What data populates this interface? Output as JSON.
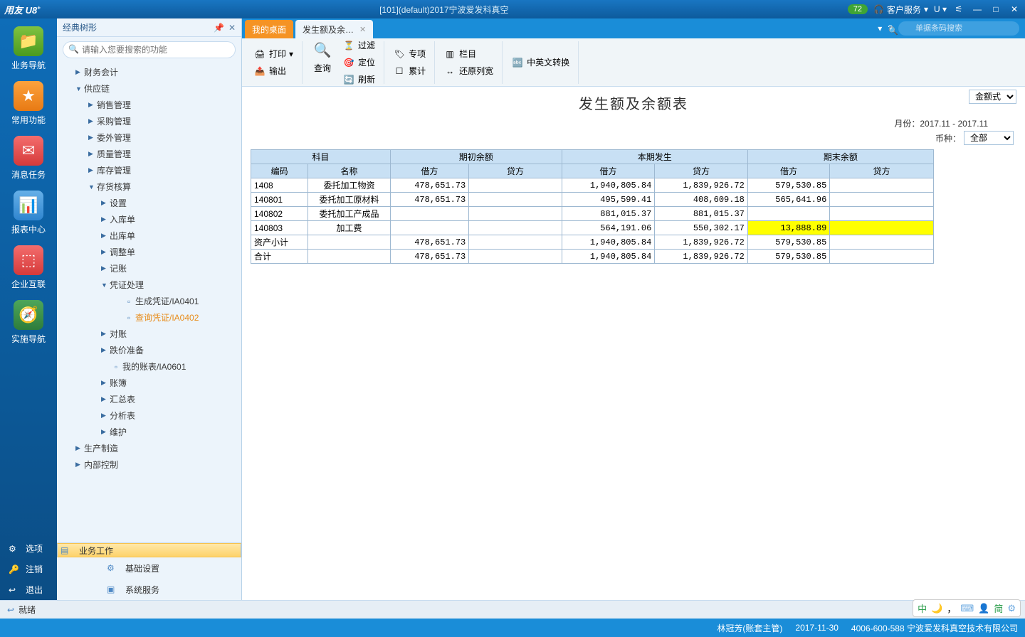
{
  "titlebar": {
    "logo": "用友 U8",
    "logo_sup": "+",
    "path": "[101](default)2017宁波爱发科真空",
    "badge": "72",
    "service": "客户服务",
    "u": "U"
  },
  "leftrail": {
    "items": [
      {
        "label": "业务导航"
      },
      {
        "label": "常用功能"
      },
      {
        "label": "消息任务"
      },
      {
        "label": "报表中心"
      },
      {
        "label": "企业互联"
      },
      {
        "label": "实施导航"
      }
    ],
    "bottom": [
      {
        "label": "选项",
        "icon": "⚙"
      },
      {
        "label": "注销",
        "icon": "🔑"
      },
      {
        "label": "退出",
        "icon": "↩"
      }
    ]
  },
  "treepanel": {
    "title": "经典树形",
    "search_placeholder": "请输入您要搜索的功能",
    "nodes": [
      {
        "lv": 1,
        "arrow": "▶",
        "label": "财务会计"
      },
      {
        "lv": 1,
        "arrow": "▼",
        "label": "供应链"
      },
      {
        "lv": 2,
        "arrow": "▶",
        "label": "销售管理"
      },
      {
        "lv": 2,
        "arrow": "▶",
        "label": "采购管理"
      },
      {
        "lv": 2,
        "arrow": "▶",
        "label": "委外管理"
      },
      {
        "lv": 2,
        "arrow": "▶",
        "label": "质量管理"
      },
      {
        "lv": 2,
        "arrow": "▶",
        "label": "库存管理"
      },
      {
        "lv": 2,
        "arrow": "▼",
        "label": "存货核算"
      },
      {
        "lv": 3,
        "arrow": "▶",
        "label": "设置"
      },
      {
        "lv": 3,
        "arrow": "▶",
        "label": "入库单"
      },
      {
        "lv": 3,
        "arrow": "▶",
        "label": "出库单"
      },
      {
        "lv": 3,
        "arrow": "▶",
        "label": "调整单"
      },
      {
        "lv": 3,
        "arrow": "▶",
        "label": "记账"
      },
      {
        "lv": 3,
        "arrow": "▼",
        "label": "凭证处理"
      },
      {
        "lv": 4,
        "arrow": "",
        "icon": "▫",
        "label": "生成凭证/IA0401"
      },
      {
        "lv": 4,
        "arrow": "",
        "icon": "▫",
        "label": "查询凭证/IA0402",
        "active": true
      },
      {
        "lv": 3,
        "arrow": "▶",
        "label": "对账"
      },
      {
        "lv": 3,
        "arrow": "▶",
        "label": "跌价准备"
      },
      {
        "lv": 3,
        "arrow": "",
        "icon": "▫",
        "label": "我的账表/IA0601"
      },
      {
        "lv": 3,
        "arrow": "▶",
        "label": "账簿"
      },
      {
        "lv": 3,
        "arrow": "▶",
        "label": "汇总表"
      },
      {
        "lv": 3,
        "arrow": "▶",
        "label": "分析表"
      },
      {
        "lv": 3,
        "arrow": "▶",
        "label": "维护"
      },
      {
        "lv": 1,
        "arrow": "▶",
        "label": "生产制造"
      },
      {
        "lv": 1,
        "arrow": "▶",
        "label": "内部控制"
      }
    ],
    "footer": [
      {
        "label": "业务工作",
        "sel": true,
        "icon": "▤"
      },
      {
        "label": "基础设置",
        "sel": false,
        "icon": "⚙"
      },
      {
        "label": "系统服务",
        "sel": false,
        "icon": "▣"
      }
    ]
  },
  "tabs": {
    "desktop": "我的桌面",
    "active": "发生额及余…",
    "search_placeholder": "单据条码搜索"
  },
  "toolbar": {
    "print": "打印",
    "output": "输出",
    "query": "查询",
    "filter": "过滤",
    "locate": "定位",
    "refresh": "刷新",
    "spec": "专项",
    "cum": "累计",
    "column": "栏目",
    "restore": "还原列宽",
    "ce": "中英文转换"
  },
  "report": {
    "title": "发生额及余额表",
    "month_label": "月份：",
    "month_value": "2017.11 - 2017.11",
    "currency_label": "币种：",
    "currency_value": "全部",
    "money_label": "金额式",
    "headers": {
      "subject": "科目",
      "code": "编码",
      "name": "名称",
      "begin": "期初余额",
      "period": "本期发生",
      "end": "期末余额",
      "dr": "借方",
      "cr": "贷方"
    },
    "rows": [
      {
        "code": "1408",
        "name": "委托加工物资",
        "bdr": "478,651.73",
        "bcr": "",
        "pdr": "1,940,805.84",
        "pcr": "1,839,926.72",
        "edr": "579,530.85",
        "ecr": ""
      },
      {
        "code": "140801",
        "name": "委托加工原材料",
        "bdr": "478,651.73",
        "bcr": "",
        "pdr": "495,599.41",
        "pcr": "408,609.18",
        "edr": "565,641.96",
        "ecr": ""
      },
      {
        "code": "140802",
        "name": "委托加工产成品",
        "bdr": "",
        "bcr": "",
        "pdr": "881,015.37",
        "pcr": "881,015.37",
        "edr": "",
        "ecr": ""
      },
      {
        "code": "140803",
        "name": "加工费",
        "bdr": "",
        "bcr": "",
        "pdr": "564,191.06",
        "pcr": "550,302.17",
        "edr": "13,888.89",
        "ecr": "",
        "hl": true
      },
      {
        "code": "资产小计",
        "name": "",
        "bdr": "478,651.73",
        "bcr": "",
        "pdr": "1,940,805.84",
        "pcr": "1,839,926.72",
        "edr": "579,530.85",
        "ecr": ""
      },
      {
        "code": "合计",
        "name": "",
        "bdr": "478,651.73",
        "bcr": "",
        "pdr": "1,940,805.84",
        "pcr": "1,839,926.72",
        "edr": "579,530.85",
        "ecr": ""
      }
    ]
  },
  "status": {
    "ready": "就绪",
    "user": "林冠芳(账套主管)",
    "date": "2017-11-30",
    "hotline": "4006-600-588 宁波爱发科真空技术有限公司",
    "ime": "中",
    "simp": "简"
  }
}
